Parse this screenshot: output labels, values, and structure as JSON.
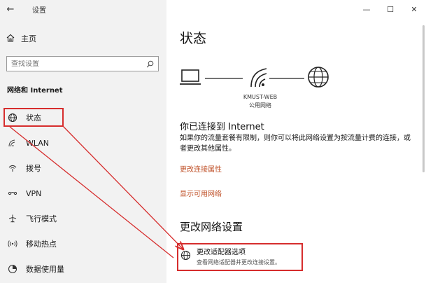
{
  "window": {
    "title": "设置",
    "back_icon": "back-arrow-icon",
    "controls": [
      "minimize-icon",
      "maximize-icon",
      "close-icon"
    ]
  },
  "sidebar": {
    "home": {
      "label": "主页",
      "icon": "home-icon"
    },
    "search": {
      "placeholder": "查找设置",
      "icon": "search-icon"
    },
    "section_title": "网络和 Internet",
    "items": [
      {
        "label": "状态",
        "icon": "globe-status-icon",
        "active": true
      },
      {
        "label": "WLAN",
        "icon": "wifi-icon",
        "active": false
      },
      {
        "label": "拨号",
        "icon": "dialup-icon",
        "active": false
      },
      {
        "label": "VPN",
        "icon": "vpn-icon",
        "active": false
      },
      {
        "label": "飞行模式",
        "icon": "airplane-icon",
        "active": false
      },
      {
        "label": "移动热点",
        "icon": "hotspot-icon",
        "active": false
      },
      {
        "label": "数据使用量",
        "icon": "data-usage-icon",
        "active": false
      }
    ]
  },
  "main": {
    "title": "状态",
    "network": {
      "name": "KMUST-WEB",
      "type": "公用网络",
      "icons": [
        "laptop-icon",
        "wifi-signal-icon",
        "globe-icon"
      ]
    },
    "connected": {
      "heading": "你已连接到 Internet",
      "description": "如果你的流量套餐有限制，则你可以将此网络设置为按流量计费的连接，或者更改其他属性。"
    },
    "links": {
      "change_properties": "更改连接属性",
      "show_networks": "显示可用网络"
    },
    "change_settings": {
      "title": "更改网络设置",
      "adapter_title": "更改适配器选项",
      "adapter_desc": "查看网络适配器并更改连接设置。",
      "adapter_icon": "globe-adapter-icon"
    }
  },
  "annotation": {
    "highlight_color": "#d62d2d"
  }
}
